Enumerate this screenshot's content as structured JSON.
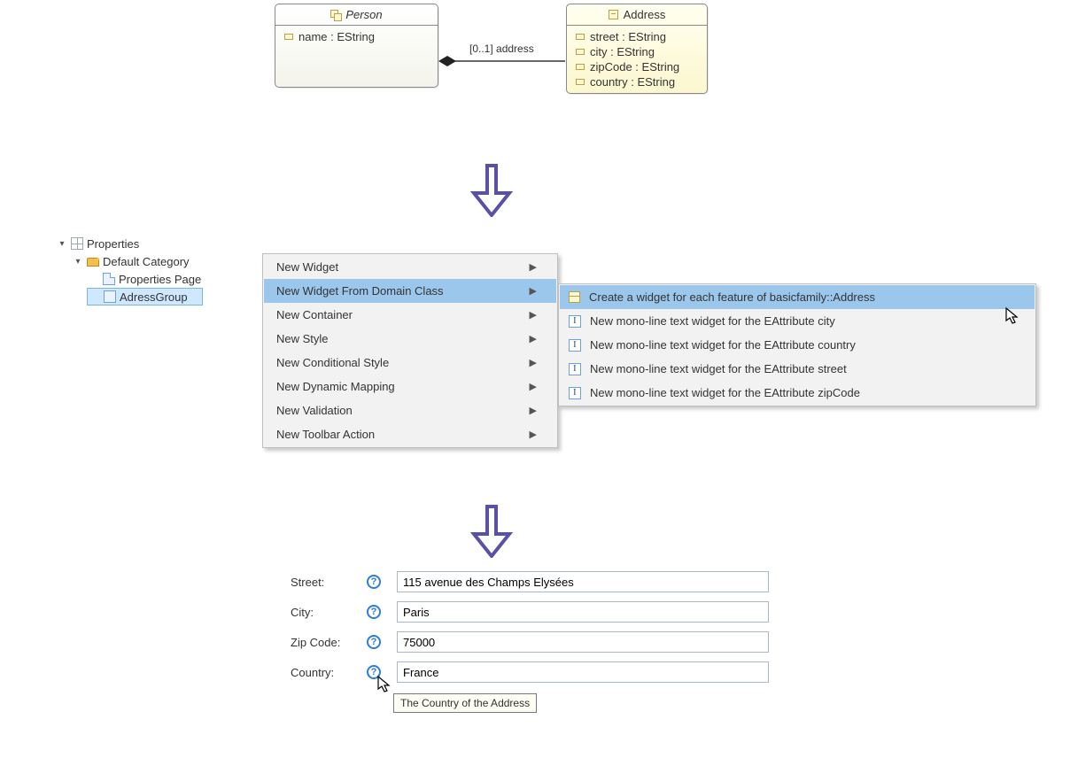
{
  "uml": {
    "person": {
      "title": "Person",
      "attrs": [
        "name : EString"
      ]
    },
    "address": {
      "title": "Address",
      "attrs": [
        "street : EString",
        "city : EString",
        "zipCode : EString",
        "country : EString"
      ]
    },
    "assoc_label": "[0..1] address"
  },
  "tree": {
    "root": "Properties",
    "category": "Default Category",
    "page": "Properties Page",
    "group": "AdressGroup"
  },
  "menu": {
    "items": [
      "New Widget",
      "New Widget From Domain Class",
      "New Container",
      "New Style",
      "New Conditional Style",
      "New Dynamic Mapping",
      "New Validation",
      "New Toolbar Action"
    ]
  },
  "submenu": {
    "items": [
      "Create a widget for each feature of basicfamily::Address",
      "New mono-line text widget for the EAttribute city",
      "New mono-line text widget for the EAttribute country",
      "New mono-line text widget for the EAttribute street",
      "New mono-line text widget for the EAttribute zipCode"
    ]
  },
  "form": {
    "street": {
      "label": "Street:",
      "value": "115 avenue des Champs Elysées"
    },
    "city": {
      "label": "City:",
      "value": "Paris"
    },
    "zip": {
      "label": "Zip Code:",
      "value": "75000"
    },
    "country": {
      "label": "Country:",
      "value": "France"
    },
    "tooltip": "The Country of the Address"
  }
}
